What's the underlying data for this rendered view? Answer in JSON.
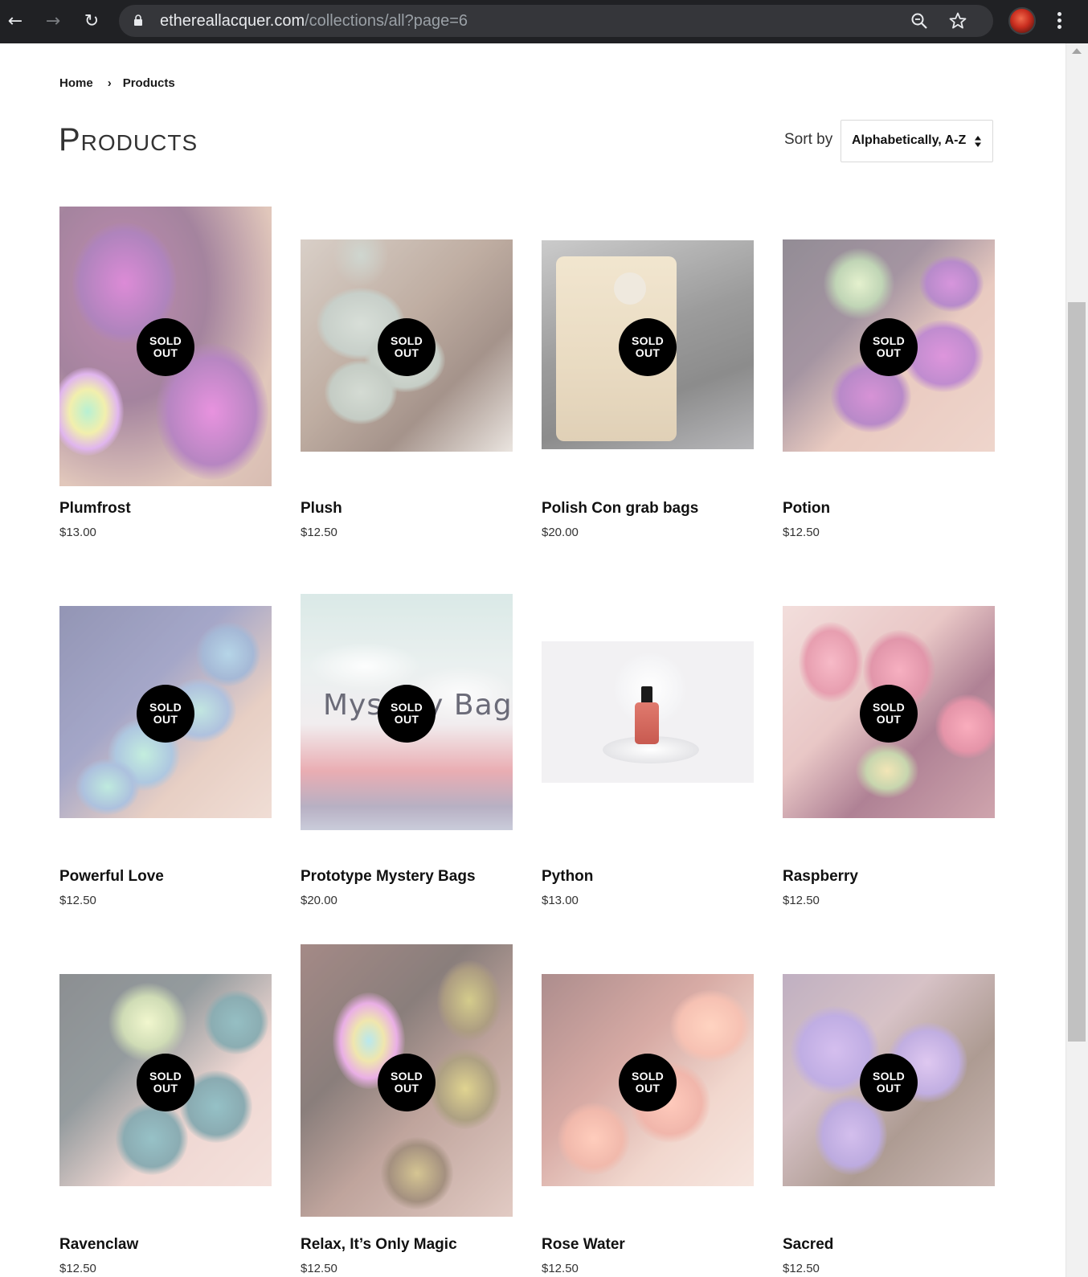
{
  "browser": {
    "url_domain": "ethereallacquer.com",
    "url_path": "/collections/all?page=6"
  },
  "breadcrumb": {
    "home": "Home",
    "separator": "›",
    "current": "Products"
  },
  "page": {
    "title": "Products"
  },
  "sort": {
    "label": "Sort by",
    "selected": "Alphabetically, A-Z"
  },
  "badge": {
    "line1": "SOLD",
    "line2": "OUT"
  },
  "products": [
    {
      "name": "Plumfrost",
      "price": "$13.00",
      "sold_out": true
    },
    {
      "name": "Plush",
      "price": "$12.50",
      "sold_out": true
    },
    {
      "name": "Polish Con grab bags",
      "price": "$20.00",
      "sold_out": true
    },
    {
      "name": "Potion",
      "price": "$12.50",
      "sold_out": true
    },
    {
      "name": "Powerful Love",
      "price": "$12.50",
      "sold_out": true
    },
    {
      "name": "Prototype Mystery Bags",
      "price": "$20.00",
      "sold_out": true,
      "image_text": "Mystery Bags"
    },
    {
      "name": "Python",
      "price": "$13.00",
      "sold_out": false
    },
    {
      "name": "Raspberry",
      "price": "$12.50",
      "sold_out": true
    },
    {
      "name": "Ravenclaw",
      "price": "$12.50",
      "sold_out": true
    },
    {
      "name": "Relax, It’s Only Magic",
      "price": "$12.50",
      "sold_out": true
    },
    {
      "name": "Rose Water",
      "price": "$12.50",
      "sold_out": true
    },
    {
      "name": "Sacred",
      "price": "$12.50",
      "sold_out": true
    }
  ]
}
